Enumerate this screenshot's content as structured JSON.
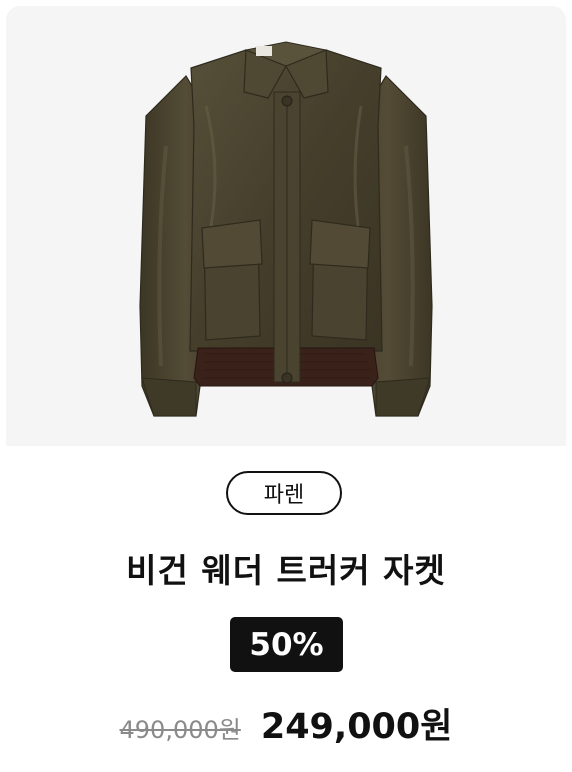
{
  "product": {
    "brand": "파렌",
    "name": "비건 웨더 트러커 자켓",
    "discount": "50%",
    "original_price": "490,000원",
    "sale_price": "249,000원",
    "image_alt": "jacket-image",
    "colors": {
      "image_background": "#f5f5f5",
      "jacket": "#4b4430",
      "badge_background": "#111111",
      "original_price": "#8a8a8a"
    }
  }
}
